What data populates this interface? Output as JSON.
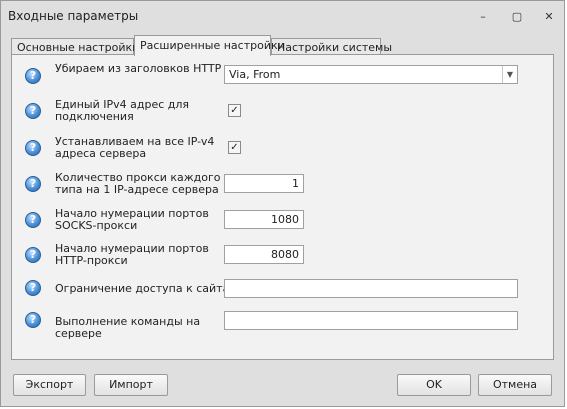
{
  "window": {
    "title": "Входные параметры",
    "minimize_glyph": "–",
    "restore_glyph": "▢",
    "close_glyph": "✕"
  },
  "tabs": [
    {
      "label": "Основные настройки",
      "active": false
    },
    {
      "label": "Расширенные настройки",
      "active": true
    },
    {
      "label": "Настройки системы",
      "active": false
    }
  ],
  "params": [
    {
      "label": "Убираем из заголовков HTTP",
      "control": "combo",
      "value": "Via, From"
    },
    {
      "label": "Единый IPv4 адрес для подключения",
      "control": "checkbox",
      "checked": true
    },
    {
      "label": "Устанавливаем на все IP-v4 адреса сервера",
      "control": "checkbox",
      "checked": true
    },
    {
      "label": "Количество прокси каждого типа на 1 IP-адресе сервера",
      "control": "number",
      "value": "1"
    },
    {
      "label": "Начало нумерации портов SOCKS-прокси",
      "control": "number",
      "value": "1080"
    },
    {
      "label": "Начало нумерации портов HTTP-прокси",
      "control": "number",
      "value": "8080"
    },
    {
      "label": "Ограничение доступа к сайтам",
      "control": "text",
      "value": ""
    },
    {
      "label": "Выполнение команды на сервере",
      "control": "text",
      "value": ""
    }
  ],
  "help_glyph": "?",
  "check_glyph": "✓",
  "combo_arrow_glyph": "▼",
  "buttons": {
    "export": "Экспорт",
    "import": "Импорт",
    "ok": "OK",
    "cancel": "Отмена"
  }
}
